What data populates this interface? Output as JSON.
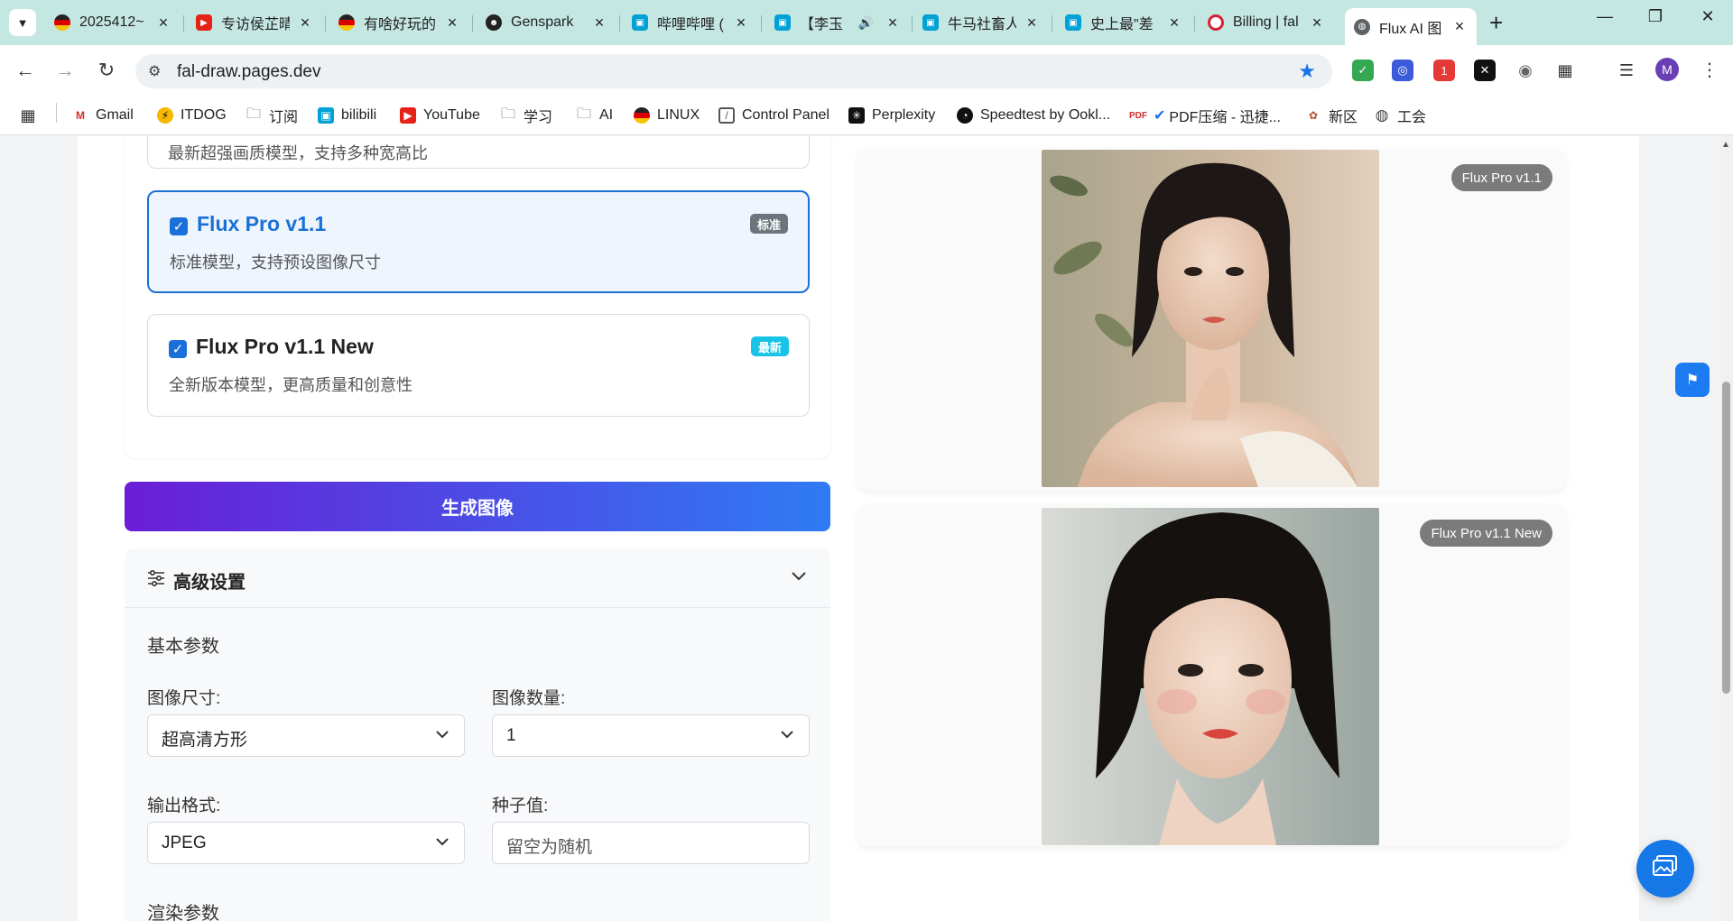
{
  "browser": {
    "tabs": [
      {
        "title": "2025412~",
        "favicon": "circle-flag-icon"
      },
      {
        "title": "专访侯芷晴",
        "favicon": "youtube-icon"
      },
      {
        "title": "有啥好玩的",
        "favicon": "circle-flag-icon"
      },
      {
        "title": "Genspark",
        "favicon": "genspark-icon"
      },
      {
        "title": "哔哩哔哩 (",
        "favicon": "bilibili-icon"
      },
      {
        "title": "【李玉",
        "favicon": "bilibili-icon"
      },
      {
        "title": "牛马社畜人",
        "favicon": "bilibili-icon"
      },
      {
        "title": "史上最\"差",
        "favicon": "bilibili-icon"
      },
      {
        "title": "Billing | fal",
        "favicon": "fal-icon"
      },
      {
        "title": "Flux AI 图",
        "favicon": "globe-icon"
      }
    ],
    "url": "fal-draw.pages.dev",
    "avatar_letter": "M",
    "extension_badge": "1",
    "bookmarks": [
      {
        "label": "Gmail"
      },
      {
        "label": "ITDOG"
      },
      {
        "label": "订阅"
      },
      {
        "label": "bilibili"
      },
      {
        "label": "YouTube"
      },
      {
        "label": "学习"
      },
      {
        "label": "AI"
      },
      {
        "label": "LINUX"
      },
      {
        "label": "Control Panel"
      },
      {
        "label": "Perplexity"
      },
      {
        "label": "Speedtest by Ookl..."
      },
      {
        "label": "PDF压缩 - 迅捷..."
      },
      {
        "label": "新区"
      },
      {
        "label": "工会"
      }
    ]
  },
  "models": {
    "partial_desc": "最新超强画质模型，支持多种宽高比",
    "items": [
      {
        "name": "Flux Pro v1.1",
        "desc": "标准模型，支持预设图像尺寸",
        "badge": "标准",
        "badge_color": "#6c757d",
        "checked": true
      },
      {
        "name": "Flux Pro v1.1 New",
        "desc": "全新版本模型，更高质量和创意性",
        "badge": "最新",
        "badge_color": "#17c3e6",
        "checked": true
      }
    ]
  },
  "generate_button": "生成图像",
  "advanced": {
    "title": "高级设置",
    "basic_section": "基本参数",
    "image_size_label": "图像尺寸:",
    "image_size_value": "超高清方形",
    "image_count_label": "图像数量:",
    "image_count_value": "1",
    "output_format_label": "输出格式:",
    "output_format_value": "JPEG",
    "seed_label": "种子值:",
    "seed_placeholder": "留空为随机",
    "render_section": "渲染参数"
  },
  "results": [
    {
      "tag": "Flux Pro v1.1"
    },
    {
      "tag": "Flux Pro v1.1 New"
    }
  ],
  "colors": {
    "accent": "#1a6fd8",
    "gradient_start": "#6a1ed6",
    "gradient_end": "#2f7bf5",
    "tab_strip": "#c5e7e2"
  }
}
